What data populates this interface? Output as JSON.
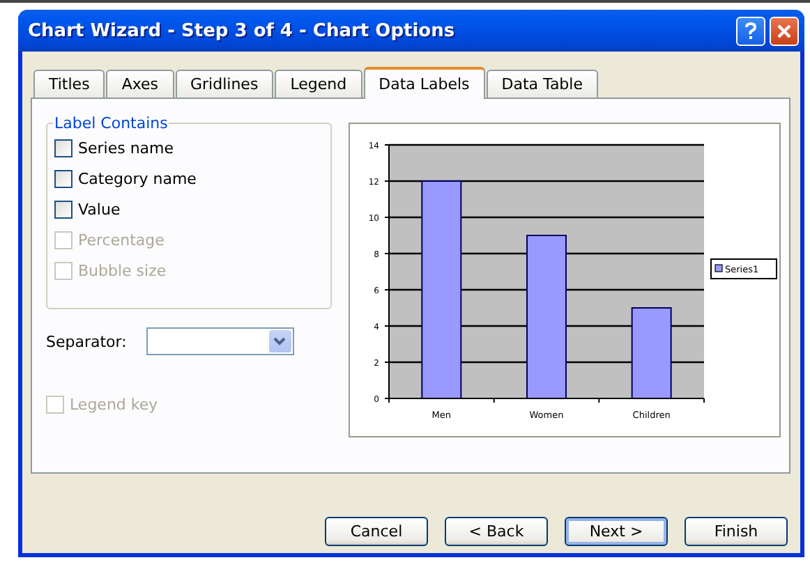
{
  "window": {
    "title": "Chart Wizard - Step 3 of 4 - Chart Options"
  },
  "tabs": [
    {
      "label": "Titles",
      "selected": false
    },
    {
      "label": "Axes",
      "selected": false
    },
    {
      "label": "Gridlines",
      "selected": false
    },
    {
      "label": "Legend",
      "selected": false
    },
    {
      "label": "Data Labels",
      "selected": true
    },
    {
      "label": "Data Table",
      "selected": false
    }
  ],
  "label_contains": {
    "title": "Label Contains",
    "options": [
      {
        "label": "Series name",
        "checked": false,
        "disabled": false
      },
      {
        "label": "Category name",
        "checked": false,
        "disabled": false
      },
      {
        "label": "Value",
        "checked": false,
        "disabled": false
      },
      {
        "label": "Percentage",
        "checked": false,
        "disabled": true
      },
      {
        "label": "Bubble size",
        "checked": false,
        "disabled": true
      }
    ]
  },
  "separator": {
    "label": "Separator:"
  },
  "legend_key": {
    "label": "Legend key",
    "checked": false,
    "disabled": true
  },
  "preview": {
    "chart_data": {
      "type": "bar",
      "categories": [
        "Men",
        "Women",
        "Children"
      ],
      "series": [
        {
          "name": "Series1",
          "color": "#9999ff",
          "values": [
            12,
            9,
            5
          ]
        }
      ],
      "ylim": [
        0,
        14
      ],
      "grid": true,
      "yticks": [
        0,
        2,
        4,
        6,
        8,
        10,
        12,
        14
      ]
    }
  },
  "buttons": [
    {
      "label": "Cancel",
      "default": false
    },
    {
      "label": "< Back",
      "default": false
    },
    {
      "label": "Next >",
      "default": true
    },
    {
      "label": "Finish",
      "default": false
    }
  ]
}
